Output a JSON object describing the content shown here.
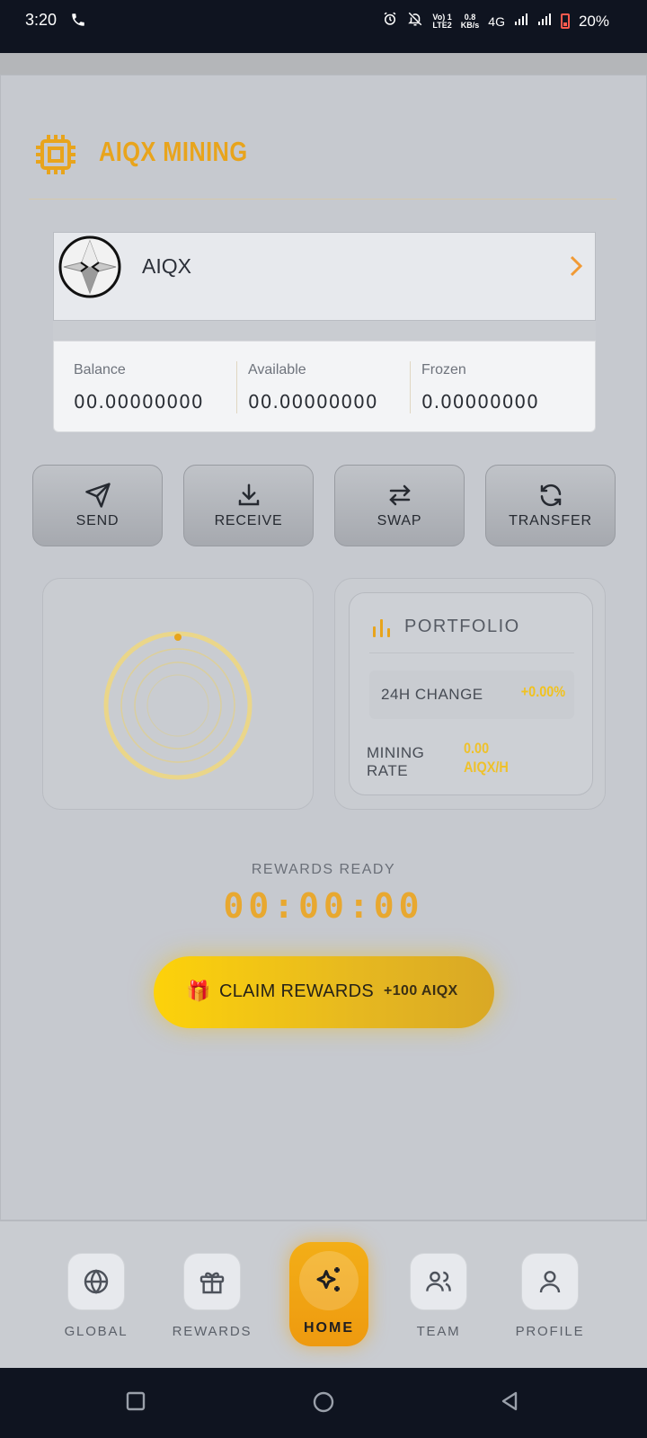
{
  "status_bar": {
    "time": "3:20",
    "network_top": "Vo) 1",
    "network_bottom": "LTE2",
    "speed_top": "0.8",
    "speed_bottom": "KB/s",
    "network_type": "4G",
    "battery": "20%"
  },
  "header": {
    "brand": "AIQX MINING",
    "brand_color": "#e8a41c"
  },
  "wallet": {
    "coin_name": "AIQX",
    "balances": [
      {
        "label": "Balance",
        "value": "00.00000000"
      },
      {
        "label": "Available",
        "value": "00.00000000"
      },
      {
        "label": "Frozen",
        "value": "0.00000000"
      }
    ]
  },
  "actions": [
    {
      "label": "SEND",
      "icon": "send-icon"
    },
    {
      "label": "RECEIVE",
      "icon": "download-icon"
    },
    {
      "label": "SWAP",
      "icon": "swap-icon"
    },
    {
      "label": "TRANSFER",
      "icon": "refresh-icon"
    }
  ],
  "portfolio": {
    "title": "PORTFOLIO",
    "change_label": "24H CHANGE",
    "change_value": "+0.00%",
    "rate_label_1": "MINING",
    "rate_label_2": "RATE",
    "rate_value_1": "0.00",
    "rate_value_2": "AIQX/H"
  },
  "rewards": {
    "label": "REWARDS READY",
    "timer": "00:00:00",
    "claim_label": "CLAIM REWARDS",
    "claim_bonus": "+100 AIQX",
    "accent_color": "#e8a830"
  },
  "nav": [
    {
      "label": "GLOBAL",
      "icon": "globe-icon"
    },
    {
      "label": "REWARDS",
      "icon": "gift-icon"
    },
    {
      "label": "HOME",
      "icon": "sparkle-icon",
      "active": true
    },
    {
      "label": "TEAM",
      "icon": "users-icon"
    },
    {
      "label": "PROFILE",
      "icon": "user-icon"
    }
  ]
}
